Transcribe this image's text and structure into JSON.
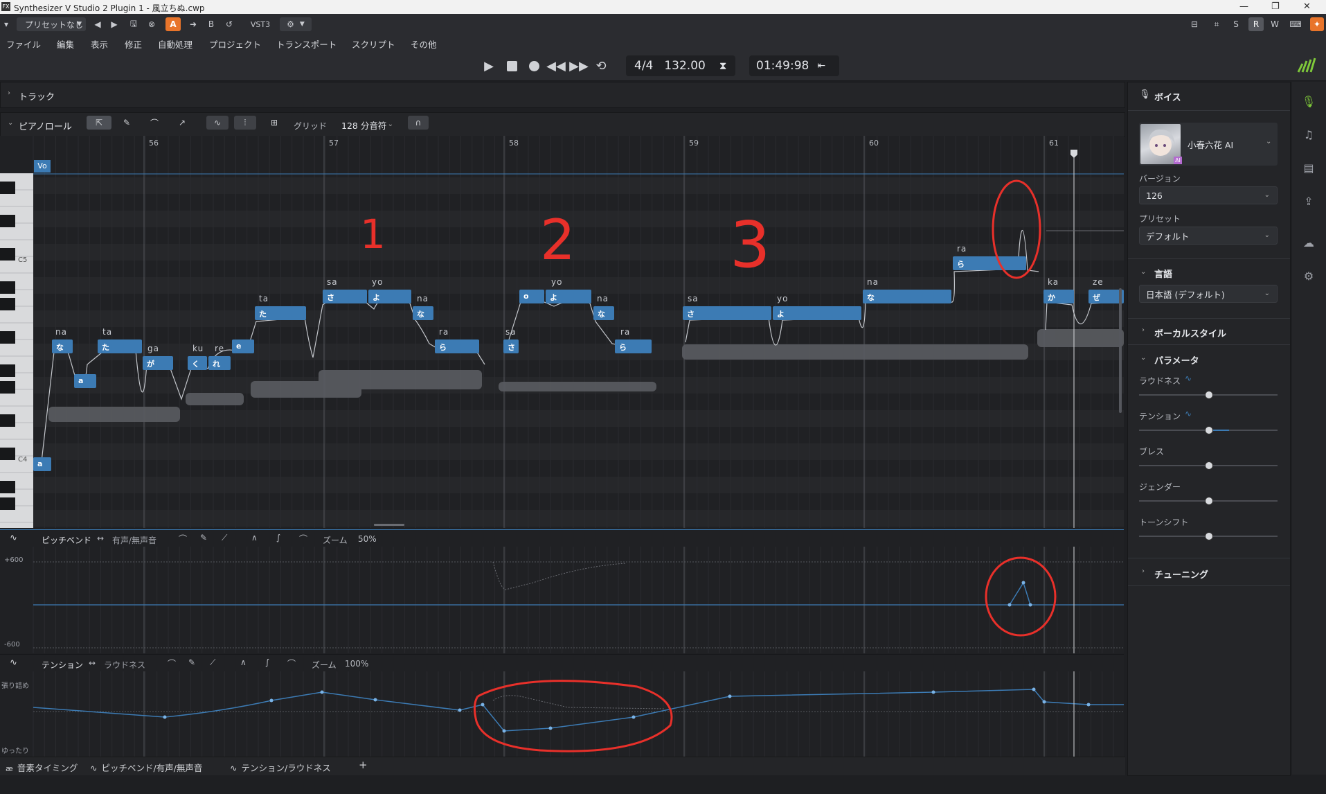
{
  "window": {
    "title": "Synthesizer V Studio 2 Plugin 1 - 風立ちぬ.cwp"
  },
  "toolbar": {
    "preset_label": "プリセットなし",
    "a_label": "A",
    "b_label": "B",
    "vst_label": "VST3",
    "right_letters": [
      "S",
      "R",
      "W"
    ]
  },
  "menu": [
    "ファイル",
    "編集",
    "表示",
    "修正",
    "自動処理",
    "プロジェクト",
    "トランスポート",
    "スクリプト",
    "その他"
  ],
  "transport": {
    "time_signature": "4/4",
    "tempo": "132.00",
    "time": "01:49:98"
  },
  "track_panel": {
    "label": "トラック"
  },
  "piano_roll": {
    "label": "ピアノロール",
    "grid_label": "グリッド",
    "grid_value": "128 分音符",
    "bars": [
      "56",
      "57",
      "58",
      "59",
      "60",
      "61"
    ],
    "track_badge": "Vo",
    "key_labels": [
      "C5",
      "C4"
    ],
    "notes": [
      {
        "phoneme": "na",
        "char": "な"
      },
      {
        "phoneme": "",
        "char": "a"
      },
      {
        "phoneme": "ta",
        "char": "た"
      },
      {
        "phoneme": "ga",
        "char": "が"
      },
      {
        "phoneme": "ku",
        "char": "く"
      },
      {
        "phoneme": "re",
        "char": "れ"
      },
      {
        "phoneme": "",
        "char": "e"
      },
      {
        "phoneme": "ta",
        "char": "た"
      },
      {
        "phoneme": "sa",
        "char": "さ"
      },
      {
        "phoneme": "yo",
        "char": "よ"
      },
      {
        "phoneme": "na",
        "char": "な"
      },
      {
        "phoneme": "ra",
        "char": "ら"
      },
      {
        "phoneme": "sa",
        "char": "さ"
      },
      {
        "phoneme": "",
        "char": "o"
      },
      {
        "phoneme": "yo",
        "char": "よ"
      },
      {
        "phoneme": "na",
        "char": "な"
      },
      {
        "phoneme": "ra",
        "char": "ら"
      },
      {
        "phoneme": "sa",
        "char": "さ"
      },
      {
        "phoneme": "yo",
        "char": "よ"
      },
      {
        "phoneme": "na",
        "char": "な"
      },
      {
        "phoneme": "ra",
        "char": "ら"
      },
      {
        "phoneme": "ka",
        "char": "か"
      },
      {
        "phoneme": "ze",
        "char": "ぜ"
      },
      {
        "phoneme": "",
        "char": "a"
      }
    ],
    "annotations": [
      "1",
      "2",
      "3"
    ]
  },
  "pitch_panel": {
    "title": "ピッチベンド",
    "alt": "有声/無声音",
    "zoom_label": "ズーム",
    "zoom_value": "50%",
    "top_value": "+600",
    "bottom_value": "-600"
  },
  "tension_panel": {
    "title": "テンション",
    "alt": "ラウドネス",
    "zoom_label": "ズーム",
    "zoom_value": "100%",
    "top_label": "張り詰め",
    "bottom_label": "ゆったり"
  },
  "bottom_tabs": [
    "音素タイミング",
    "ピッチベンド/有声/無声音",
    "テンション/ラウドネス",
    "+"
  ],
  "voice_panel": {
    "title": "ボイス",
    "singer": "小春六花 AI",
    "avatar_badge": "AI",
    "version_label": "バージョン",
    "version_value": "126",
    "preset_label": "プリセット",
    "preset_value": "デフォルト",
    "language_header": "言語",
    "language_value": "日本語 (デフォルト)",
    "vocal_style_header": "ボーカルスタイル",
    "parameters_header": "パラメータ",
    "parameters": [
      {
        "label": "ラウドネス",
        "value": 0.5
      },
      {
        "label": "テンション",
        "value": 0.5
      },
      {
        "label": "ブレス",
        "value": 0.5
      },
      {
        "label": "ジェンダー",
        "value": 0.5
      },
      {
        "label": "トーンシフト",
        "value": 0.5
      }
    ],
    "tuning_header": "チューニング"
  },
  "colors": {
    "accent": "#3c7bb4",
    "orange": "#e8742a",
    "annotation": "#e8302a",
    "green_icon": "#7ec83a"
  }
}
